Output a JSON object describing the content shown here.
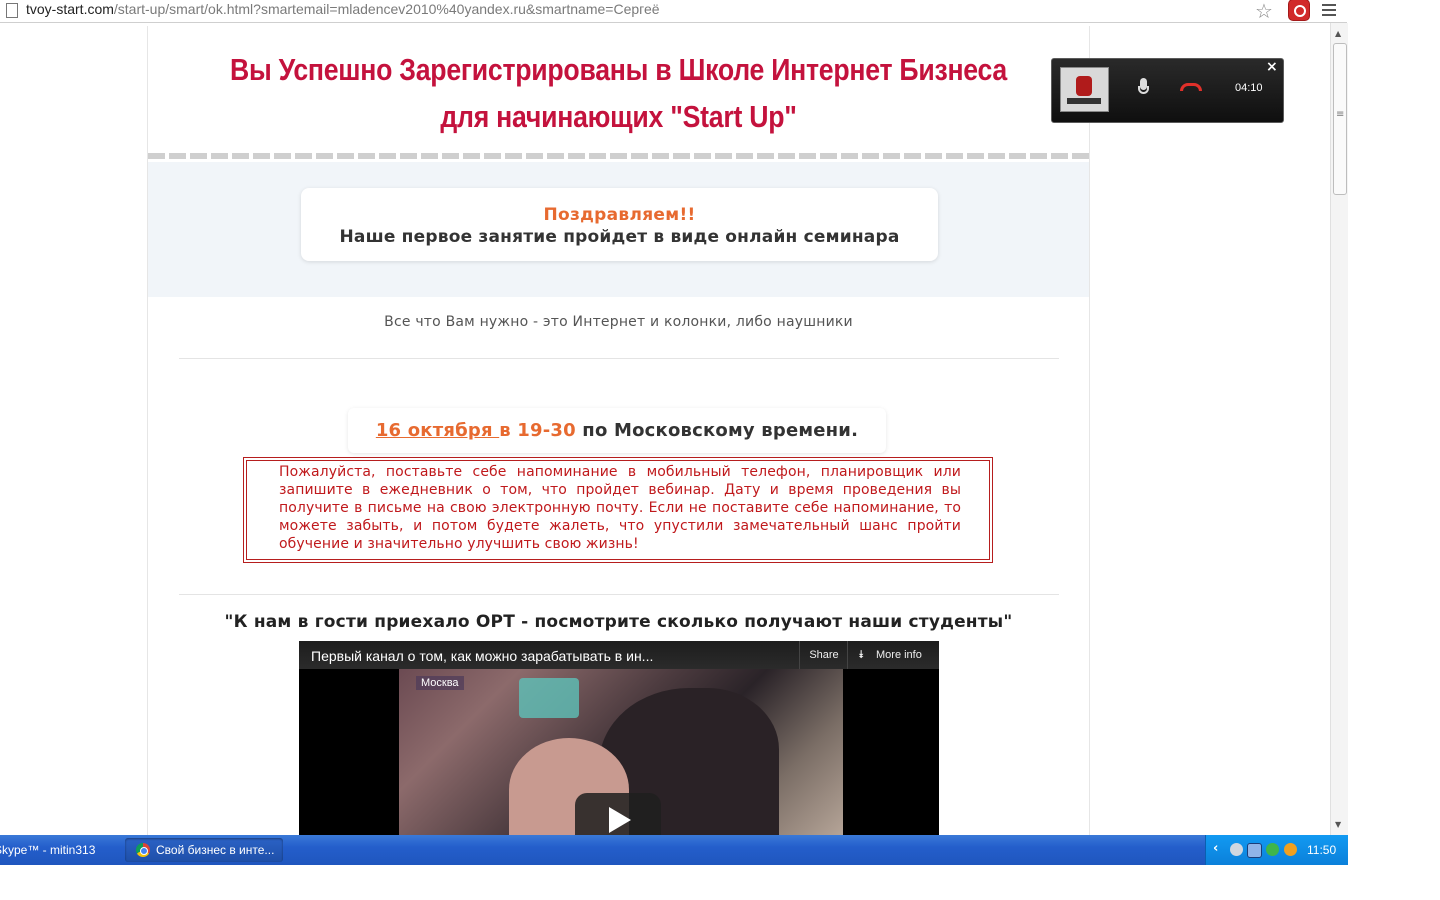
{
  "browser": {
    "url_host": "tvoy-start.com",
    "url_rest": "/start-up/smart/ok.html?smartemail=mladencev2010%40yandex.ru&smartname=Сергеё"
  },
  "page": {
    "headline_line1": "Вы Успешно Зарегистрированы в Школе Интернет Бизнеса",
    "headline_line2": "для начинающих \"Start Up\"",
    "congrats_title": "Поздравляем!!",
    "congrats_sub": "Наше первое занятие пройдет в виде онлайн семинара",
    "need_text": "Все что Вам нужно - это Интернет и колонки, либо наушники",
    "date_link": "16 октября ",
    "date_time": "в 19-30",
    "date_rest": " по Московскому времени.",
    "reminder_text": "Пожалуйста, поставьте себе напоминание в мобильный телефон, планировщик или запишите в ежедневник о том, что пройдет вебинар. Дату и время проведения вы получите в письме на свою электронную почту. Если не поставите себе напоминание, то можете забыть, и потом будете жалеть, что упустили замечательный шанс пройти обучение и значительно улучшить свою жизнь!",
    "ort_heading": "\"К нам в гости приехало ОРТ - посмотрите сколько получают наши студенты\""
  },
  "video": {
    "title": "Первый канал о том, как можно зарабатывать в ин...",
    "share_label": "Share",
    "more_info_label": "More info",
    "overlay_tag": "Москва"
  },
  "skype_call": {
    "timer": "04:10"
  },
  "taskbar": {
    "skype_label": "Skype™ - mitin313",
    "chrome_label": "Свой бизнес в инте...",
    "clock": "11:50"
  }
}
